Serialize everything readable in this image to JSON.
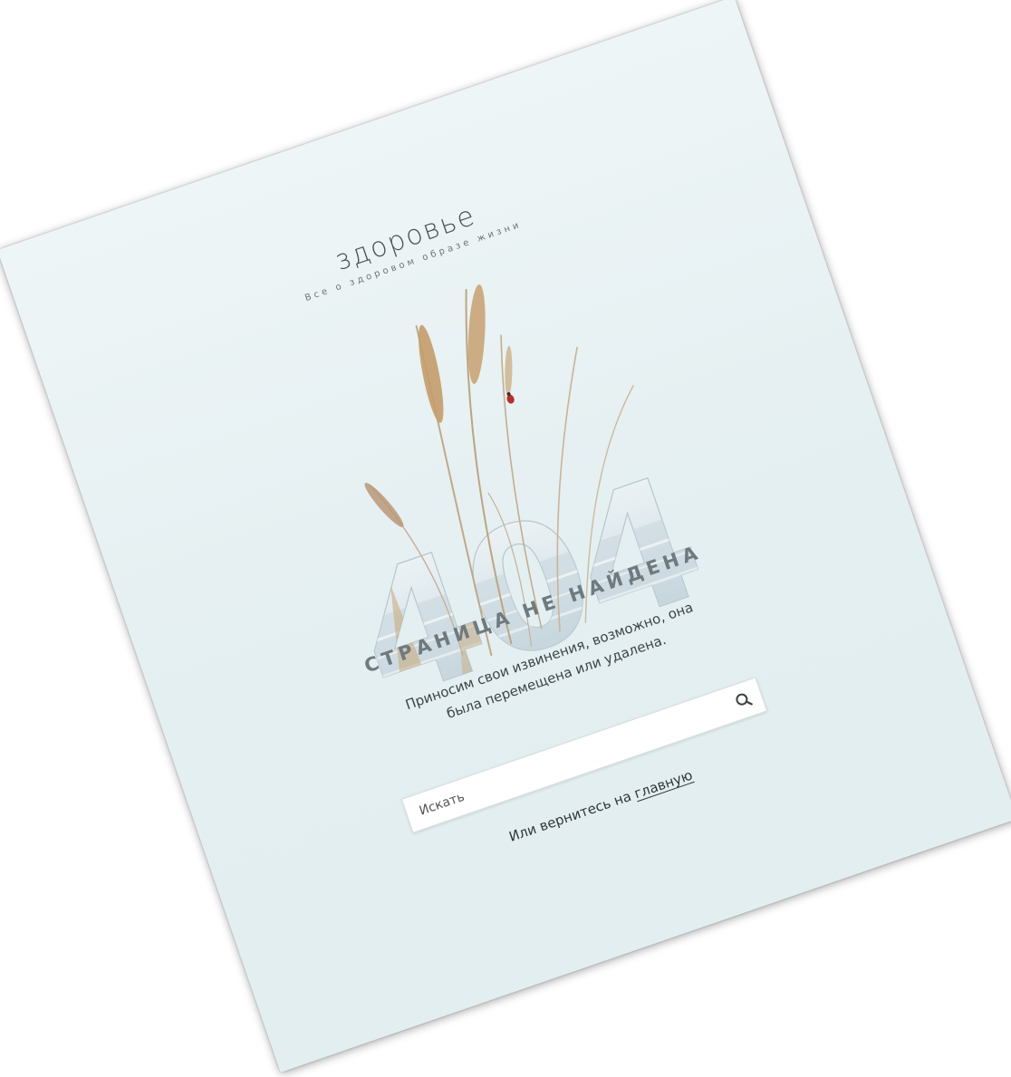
{
  "site": {
    "logo_text": "здоровье",
    "tagline": "Все о здоровом образе жизни"
  },
  "error": {
    "code": "404",
    "title": "СТРАНИЦА НЕ НАЙДЕНА",
    "message": "Приносим свои извинения, возможно, она была перемещена или удалена."
  },
  "search": {
    "placeholder": "Искать",
    "icon": "search-icon"
  },
  "back": {
    "prefix": "Или вернитесь на",
    "link_label": "главную"
  },
  "colors": {
    "page_background": "#e6f1f3",
    "heading": "#6f7a7f",
    "text": "#3d4447",
    "grass": "#c9a877"
  }
}
